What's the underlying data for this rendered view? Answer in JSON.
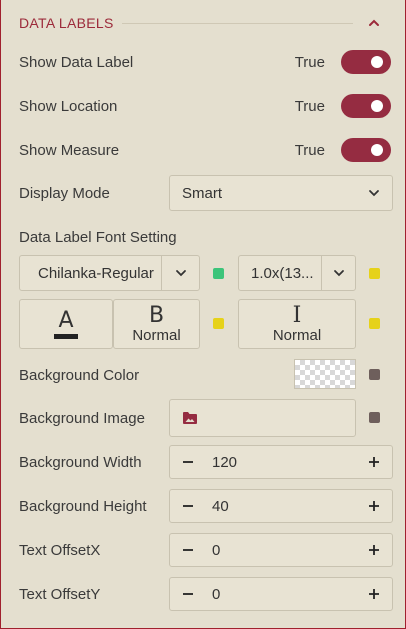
{
  "section": {
    "title": "DATA LABELS"
  },
  "toggles": [
    {
      "label": "Show Data Label",
      "value": "True"
    },
    {
      "label": "Show Location",
      "value": "True"
    },
    {
      "label": "Show Measure",
      "value": "True"
    }
  ],
  "display_mode": {
    "label": "Display Mode",
    "value": "Smart"
  },
  "font_setting": {
    "label": "Data Label Font Setting",
    "font_family": "Chilanka-Regular",
    "font_size": "1.0x(13...",
    "color_button_glyph": "A",
    "weight_glyph": "B",
    "weight_value": "Normal",
    "style_glyph": "I",
    "style_value": "Normal"
  },
  "background_color": {
    "label": "Background Color"
  },
  "background_image": {
    "label": "Background Image"
  },
  "steppers": [
    {
      "label": "Background Width",
      "value": "120"
    },
    {
      "label": "Background Height",
      "value": "40"
    },
    {
      "label": "Text OffsetX",
      "value": "0"
    },
    {
      "label": "Text OffsetY",
      "value": "0"
    }
  ],
  "colors": {
    "accent": "#952c41",
    "green_indicator": "#3cc47a",
    "yellow_indicator": "#e6d21a",
    "gray_indicator": "#6e5f5c"
  }
}
